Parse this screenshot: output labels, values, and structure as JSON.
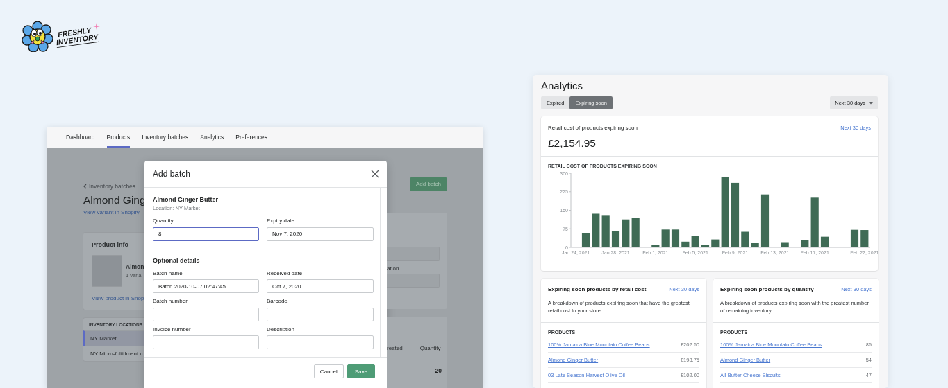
{
  "logo": {
    "lines": [
      "FRESHLY",
      "INVENTORY"
    ]
  },
  "app": {
    "nav": [
      {
        "label": "Dashboard",
        "selected": false
      },
      {
        "label": "Products",
        "selected": true
      },
      {
        "label": "Inventory batches",
        "selected": false
      },
      {
        "label": "Analytics",
        "selected": false
      },
      {
        "label": "Preferences",
        "selected": false
      }
    ],
    "background": {
      "back_link": "Inventory batches",
      "title": "Almond Ging",
      "variant_link": "View variant in Shopify",
      "add_button": "Add batch",
      "product_info": {
        "heading": "Product info",
        "name": "Almon",
        "variants": "1 varia",
        "link": "View product in Shop"
      },
      "locations": {
        "heading": "INVENTORY LOCATIONS",
        "items": [
          {
            "label": "NY Market",
            "selected": true
          },
          {
            "label": "NY Micro-fulfillment c",
            "selected": false
          }
        ]
      },
      "side_field_label": "ation",
      "table": {
        "columns": [
          "reated",
          "Quantity"
        ],
        "quantity_value": "20"
      }
    },
    "modal": {
      "title": "Add batch",
      "product": "Almond Ginger Butter",
      "location": "Location: NY Market",
      "fields": [
        {
          "label": "Quantity",
          "value": "8",
          "focused": true
        },
        {
          "label": "Expiry date",
          "value": "Nov 7, 2020",
          "focused": false
        }
      ],
      "optional_heading": "Optional details",
      "optional_fields": [
        {
          "label": "Batch name",
          "value": "Batch 2020-10-07 02:47:45",
          "focused": false
        },
        {
          "label": "Received date",
          "value": "Oct 7, 2020",
          "focused": false
        },
        {
          "label": "Batch number",
          "focused": false
        },
        {
          "label": "Barcode",
          "focused": false
        },
        {
          "label": "Invoice number",
          "focused": false
        },
        {
          "label": "Description",
          "focused": false
        }
      ],
      "buttons": [
        {
          "label": "Cancel",
          "kind": "secondary"
        },
        {
          "label": "Save",
          "kind": "primary"
        }
      ]
    }
  },
  "analytics": {
    "title": "Analytics",
    "tabs": [
      {
        "label": "Expired",
        "selected": false
      },
      {
        "label": "Expiring soon",
        "selected": true
      }
    ],
    "range": "Next 30 days",
    "summary": {
      "title": "Retail cost of products expiring soon",
      "link": "Next 30 days",
      "total": "£2,154.95",
      "chart_data": {
        "type": "bar",
        "title": "RETAIL COST OF PRODUCTS EXPIRING SOON",
        "categories": [
          "Jan 24, 2021",
          null,
          null,
          null,
          "Jan 28, 2021",
          null,
          null,
          null,
          "Feb 1, 2021",
          null,
          null,
          null,
          "Feb 5, 2021",
          null,
          null,
          null,
          "Feb 9, 2021",
          null,
          null,
          null,
          "Feb 13, 2021",
          null,
          null,
          null,
          "Feb 17, 2021",
          null,
          null,
          null,
          null,
          "Feb 22, 2021"
        ],
        "values": [
          0,
          57,
          136,
          128,
          66,
          113,
          119,
          0,
          11,
          72,
          72,
          23,
          47,
          9,
          32,
          286,
          261,
          63,
          17,
          214,
          0,
          21,
          0,
          30,
          201,
          43,
          2,
          0,
          71,
          70
        ],
        "ylim": [
          0,
          300
        ],
        "yticks": [
          0,
          75,
          150,
          225,
          300
        ]
      }
    },
    "lists": [
      {
        "title": "Expiring soon products by retail cost",
        "link": "Next 30 days",
        "description": "A breakdown of products expiring soon that have the greatest retail cost to your store.",
        "column": "PRODUCTS",
        "rows": [
          {
            "name": "100% Jamaica Blue Mountain Coffee Beans",
            "value": "£202.50"
          },
          {
            "name": "Almond Ginger Butter",
            "value": "£198.75"
          },
          {
            "name": "03 Late Season Harvest Olive Oil",
            "value": "£102.00"
          }
        ]
      },
      {
        "title": "Expiring soon products by quantity",
        "link": "Next 30 days",
        "description": "A breakdown of products expiring soon with the greatest number of remaining inventory.",
        "column": "PRODUCTS",
        "rows": [
          {
            "name": "100% Jamaica Blue Mountain Coffee Beans",
            "value": "85"
          },
          {
            "name": "Almond Ginger Butter",
            "value": "54"
          },
          {
            "name": "All-Butter Cheese Biscuits",
            "value": "47"
          }
        ]
      }
    ]
  }
}
